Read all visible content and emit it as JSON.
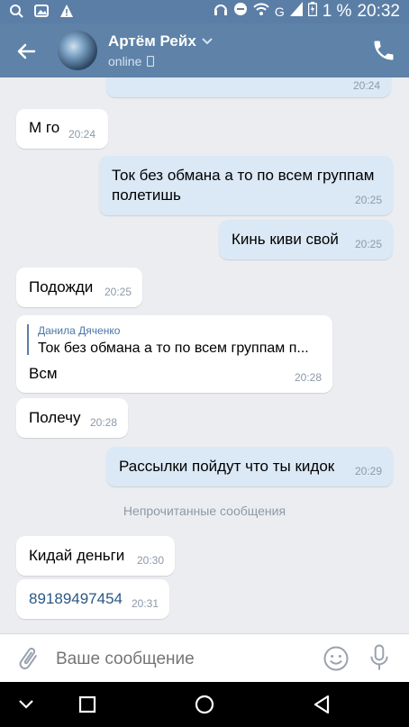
{
  "status": {
    "battery_percent": "1 %",
    "time": "20:32",
    "network": "G"
  },
  "header": {
    "name": "Артём Рейх",
    "status": "online"
  },
  "messages": [
    {
      "side": "out",
      "text": "",
      "time": "20:24"
    },
    {
      "side": "in",
      "text": "М го",
      "time": "20:24"
    },
    {
      "side": "out",
      "text": "Ток без обмана а то по всем группам полетишь",
      "time": "20:25"
    },
    {
      "side": "out",
      "text": "Кинь киви свой",
      "time": "20:25"
    },
    {
      "side": "in",
      "text": "Подожди",
      "time": "20:25"
    },
    {
      "side": "in",
      "reply_name": "Данила Дяченко",
      "reply_text": "Ток без обмана а то по всем группам п...",
      "text": "Всм",
      "time": "20:28"
    },
    {
      "side": "in",
      "text": "Полечу",
      "time": "20:28"
    },
    {
      "side": "out",
      "text": "Рассылки пойдут что ты кидок",
      "time": "20:29"
    },
    {
      "side": "in",
      "text": "Кидай деньги",
      "time": "20:30"
    },
    {
      "side": "in",
      "text": "89189497454",
      "time": "20:31"
    }
  ],
  "divider": {
    "label": "Непрочитанные сообщения"
  },
  "composer": {
    "placeholder": "Ваше сообщение"
  },
  "colors": {
    "accent": "#5e82a8",
    "outgoing": "#dbe8f5",
    "incoming": "#ffffff",
    "background": "#ebedf0"
  }
}
